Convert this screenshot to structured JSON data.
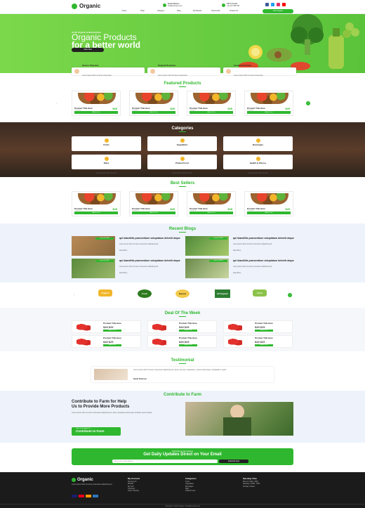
{
  "header": {
    "brand": "Organic",
    "email_label": "Email Address",
    "email_value": "info@example.com",
    "call_label": "24/7 In Touch",
    "call_value": "+00 123 456 789",
    "nav": [
      "Home",
      "Shop",
      "Category",
      "Blog",
      "Top Brands",
      "Testimonial",
      "Contact Us"
    ],
    "cta": "Get A Quote",
    "social_colors": [
      "#3b5998",
      "#1da1f2",
      "#e1306c",
      "#ff0000"
    ]
  },
  "hero": {
    "pre": "Its All Organic & Natural Here",
    "line1": "Organic Products",
    "line2": "for a better world",
    "button": "Shop Now"
  },
  "features": [
    {
      "title": "Secure Payment",
      "text": "Lorem ipsum dolor sit amet consectetur"
    },
    {
      "title": "Original Products",
      "text": "Lorem ipsum dolor sit amet consectetur"
    },
    {
      "title": "Curated Products",
      "text": "Lorem ipsum dolor sit amet consectetur"
    }
  ],
  "featured": {
    "title": "Featured Products",
    "products": [
      {
        "name": "Product Title Here",
        "sub": "Category",
        "price": "$49",
        "add": "Add to Cart"
      },
      {
        "name": "Product Title Here",
        "sub": "Category",
        "price": "$49",
        "add": "Add to Cart"
      },
      {
        "name": "Product Title Here",
        "sub": "Category",
        "price": "$49",
        "add": "Add to Cart"
      },
      {
        "name": "Product Title Here",
        "sub": "Category",
        "price": "$49",
        "add": "Add to Cart"
      }
    ]
  },
  "categories": {
    "title": "Categories",
    "items": [
      {
        "name": "Fruits",
        "text": "Lorem ipsum dolor sit amet"
      },
      {
        "name": "Vegetables",
        "text": "Lorem ipsum dolor sit amet"
      },
      {
        "name": "Beverages",
        "text": "Lorem ipsum dolor sit amet"
      },
      {
        "name": "Dairy",
        "text": "Lorem ipsum dolor sit amet"
      },
      {
        "name": "Packed Food",
        "text": "Lorem ipsum dolor sit amet"
      },
      {
        "name": "Health & Fitness",
        "text": "Lorem ipsum dolor sit amet"
      }
    ]
  },
  "best": {
    "title": "Best Sellers",
    "products": [
      {
        "name": "Product Title Here",
        "sub": "Category",
        "price": "$49",
        "add": "Add to Cart"
      },
      {
        "name": "Product Title Here",
        "sub": "Category",
        "price": "$49",
        "add": "Add to Cart"
      },
      {
        "name": "Product Title Here",
        "sub": "Category",
        "price": "$49",
        "add": "Add to Cart"
      },
      {
        "name": "Product Title Here",
        "sub": "Category",
        "price": "$49",
        "add": "Add to Cart"
      }
    ]
  },
  "blog": {
    "title": "Recent Blogs",
    "posts": [
      {
        "date": "June 15, 2022",
        "title": "qui blanditiis praesentium voluptatum deleniti atque",
        "text": "Lorem ipsum dolor sit amet consectetur adipisicing elit.",
        "more": "Read More"
      },
      {
        "date": "June 15, 2022",
        "title": "qui blanditiis praesentium voluptatum deleniti atque",
        "text": "Lorem ipsum dolor sit amet consectetur adipisicing elit.",
        "more": "Read More"
      },
      {
        "date": "June 15, 2022",
        "title": "qui blanditiis praesentium voluptatum deleniti atque",
        "text": "Lorem ipsum dolor sit amet consectetur adipisicing elit.",
        "more": "Read More"
      },
      {
        "date": "June 15, 2022",
        "title": "qui blanditiis praesentium voluptatum deleniti atque",
        "text": "Lorem ipsum dolor sit amet consectetur adipisicing elit.",
        "more": "Read More"
      }
    ]
  },
  "brands": [
    "Organic",
    "Fresh",
    "Natural",
    "All Organic",
    "Farm"
  ],
  "deals": {
    "title": "Deal Of The Week",
    "items": [
      {
        "name": "Product Title Here",
        "old": "$49",
        "price": "$49 $29",
        "add": "Add to Cart"
      },
      {
        "name": "Product Title Here",
        "old": "$49",
        "price": "$49 $29",
        "add": "Add to Cart"
      },
      {
        "name": "Product Title Here",
        "old": "$49",
        "price": "$49 $29",
        "add": "Add to Cart"
      },
      {
        "name": "Product Title Here",
        "old": "$49",
        "price": "$49 $29",
        "add": "Add to Cart"
      },
      {
        "name": "Product Title Here",
        "old": "$49",
        "price": "$49 $29",
        "add": "Add to Cart"
      },
      {
        "name": "Product Title Here",
        "old": "$49",
        "price": "$49 $29",
        "add": "Add to Cart"
      }
    ]
  },
  "testimonial": {
    "title": "Testimonial",
    "text": "Lorem ipsum dolor sit amet consectetur adipisicing elit. Quos, iste ipsa. Laudantium, ratione doloremque. Voluptatibus, quae?",
    "name": "Kevin Peterson"
  },
  "contribute": {
    "title": "Contribute to Farm",
    "h1": "Contribute to Farm for Help",
    "h2": "Us to Provide More Products",
    "text": "Lorem ipsum dolor sit amet consectetur adipisicing elit. Quia, voluptates doloremque similique ipsum beatae.",
    "btn_small": "Click on the button to",
    "btn_big": "Contribute to Farm"
  },
  "subscribe": {
    "pre": "Subscribe for the Updates",
    "title": "Get Daily Updates Direct on Your Email",
    "placeholder": "Enter your email address",
    "button": "Subscribe Now"
  },
  "footer": {
    "brand": "Organic",
    "about": "Lorem ipsum dolor sit amet consectetur adipisicing elit.",
    "col1": {
      "title": "My Account",
      "items": [
        "My Account",
        "Wishlist",
        "My Cart",
        "Checkout",
        "Order Tracking"
      ]
    },
    "col2": {
      "title": "Categories",
      "items": [
        "Fruits",
        "Vegetables",
        "Beverages",
        "Dairy",
        "Packed Food"
      ]
    },
    "col3": {
      "title": "Opening Time",
      "items": [
        "Mon-Fri: 9AM - 6PM",
        "Saturday: 10AM - 5PM",
        "Sunday: Closed"
      ]
    },
    "copyright": "Copyright © 2022 Organic. All Rights Reserved"
  }
}
